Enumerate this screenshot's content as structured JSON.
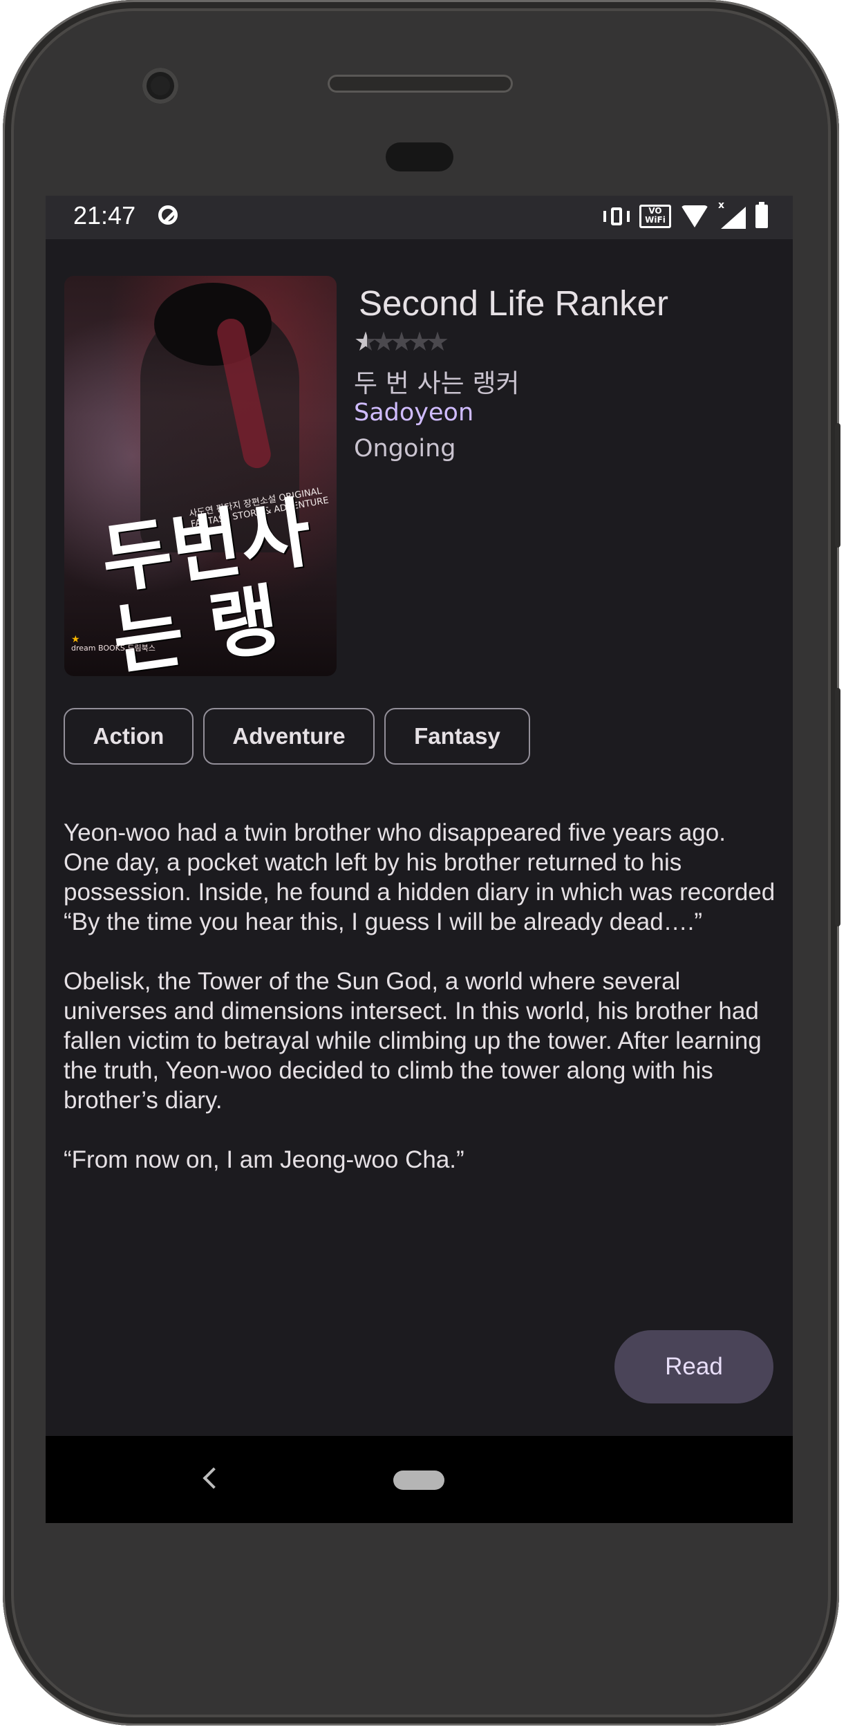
{
  "statusbar": {
    "time": "21:47",
    "icons": [
      "sync-icon",
      "vibrate-icon",
      "vowifi-icon",
      "wifi-icon",
      "signal-icon",
      "battery-icon"
    ],
    "vowifi_text_top": "VO",
    "vowifi_text_bottom": "WiFi"
  },
  "manga": {
    "title": "Second Life Ranker",
    "rating": {
      "value": 0.5,
      "max": 5
    },
    "alt_title": "두 번 사는 랭커",
    "author": "Sadoyeon",
    "status": "Ongoing",
    "cover": {
      "title_art": "두번사는 랭커",
      "subtitle": "사도연 판타지 장편소설 ORIGINAL FANTASY STORY & ADVENTURE",
      "publisher": "dream BOOKS 드림북스"
    }
  },
  "genres": [
    "Action",
    "Adventure",
    "Fantasy"
  ],
  "description": [
    "Yeon-woo had a twin brother who disappeared five years ago. One day, a pocket watch left by his brother returned to his possession. Inside, he found a hidden diary in which was recorded “By the time you hear this, I guess I will be already dead….”",
    "Obelisk, the Tower of the Sun God, a world where several universes and dimensions intersect. In this world, his brother had fallen victim to betrayal while climbing up the tower. After learning the truth, Yeon-woo decided to climb the tower along with his brother’s diary.",
    "“From now on, I am Jeong-woo Cha.”"
  ],
  "actions": {
    "read_label": "Read"
  },
  "navbar": {
    "icons": [
      "back-icon",
      "home-pill-icon"
    ]
  },
  "colors": {
    "background": "#1c1b1f",
    "author_accent": "#d0bcff",
    "read_button": "#4a4458",
    "chip_border": "#938f99"
  }
}
